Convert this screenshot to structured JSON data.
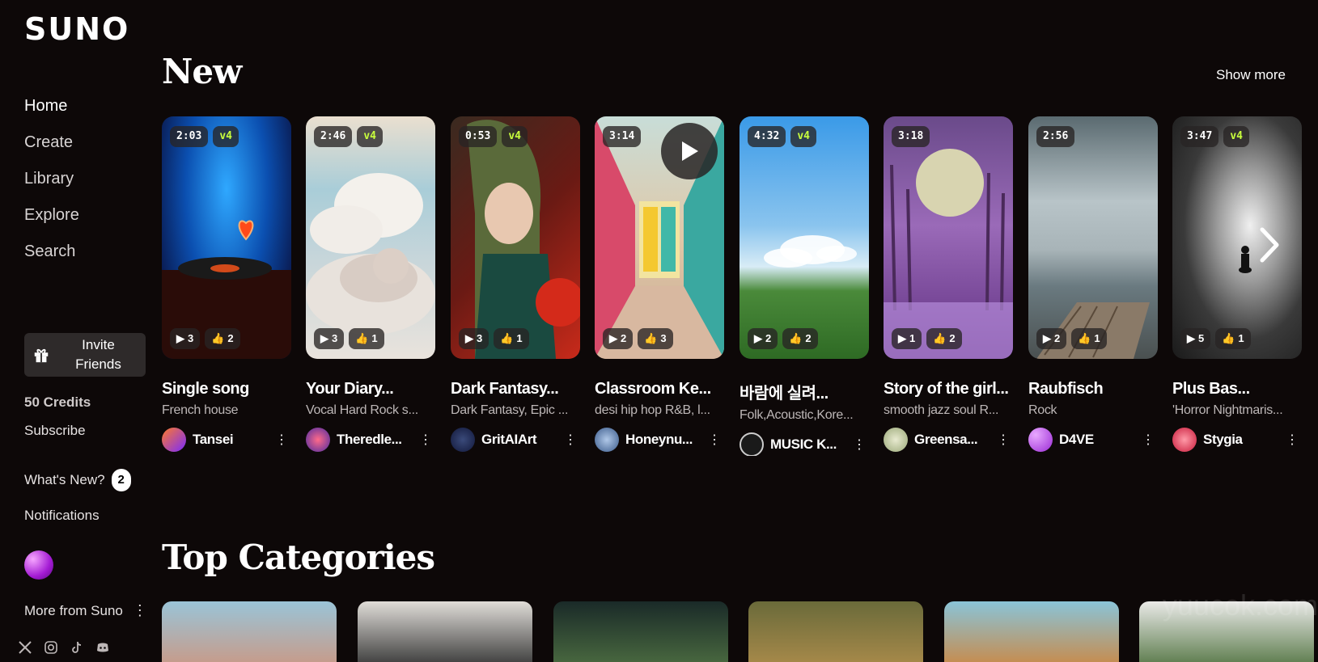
{
  "brand": {
    "logo": "SUNO"
  },
  "sidebar": {
    "nav": [
      "Home",
      "Create",
      "Library",
      "Explore",
      "Search"
    ],
    "invite_label": "Invite Friends",
    "credits": "50 Credits",
    "subscribe": "Subscribe",
    "whats_new": "What's New?",
    "whats_new_count": "2",
    "notifications": "Notifications",
    "more_from": "More from Suno",
    "social_icons": [
      "x-icon",
      "instagram-icon",
      "tiktok-icon",
      "discord-icon"
    ]
  },
  "new_section": {
    "title": "New",
    "show_more": "Show more",
    "cards": [
      {
        "duration": "2:03",
        "version": "v4",
        "plays": "3",
        "likes": "2",
        "title": "Single song",
        "style": "French house",
        "user": "Tansei"
      },
      {
        "duration": "2:46",
        "version": "v4",
        "plays": "3",
        "likes": "1",
        "title": "Your Diary...",
        "style": "Vocal Hard Rock s...",
        "user": "Theredle..."
      },
      {
        "duration": "0:53",
        "version": "v4",
        "plays": "3",
        "likes": "1",
        "title": "Dark Fantasy...",
        "style": "Dark Fantasy, Epic ...",
        "user": "GritAIArt"
      },
      {
        "duration": "3:14",
        "version": "",
        "plays": "2",
        "likes": "3",
        "title": "Classroom Ke...",
        "style": "desi hip hop R&B, l...",
        "user": "Honeynu..."
      },
      {
        "duration": "4:32",
        "version": "v4",
        "plays": "2",
        "likes": "2",
        "title": "바람에 실려...",
        "style": "Folk,Acoustic,Kore...",
        "user": "MUSIC K..."
      },
      {
        "duration": "3:18",
        "version": "",
        "plays": "1",
        "likes": "2",
        "title": "Story of the girl...",
        "style": "smooth jazz soul R...",
        "user": "Greensa..."
      },
      {
        "duration": "2:56",
        "version": "",
        "plays": "2",
        "likes": "1",
        "title": "Raubfisch",
        "style": "Rock",
        "user": "D4VE"
      },
      {
        "duration": "3:47",
        "version": "v4",
        "plays": "5",
        "likes": "1",
        "title": "Plus Bas...",
        "style": "'Horror Nightmaris...",
        "user": "Stygia"
      }
    ]
  },
  "top_categories": {
    "title": "Top Categories"
  },
  "watermark": "yuucok.com"
}
